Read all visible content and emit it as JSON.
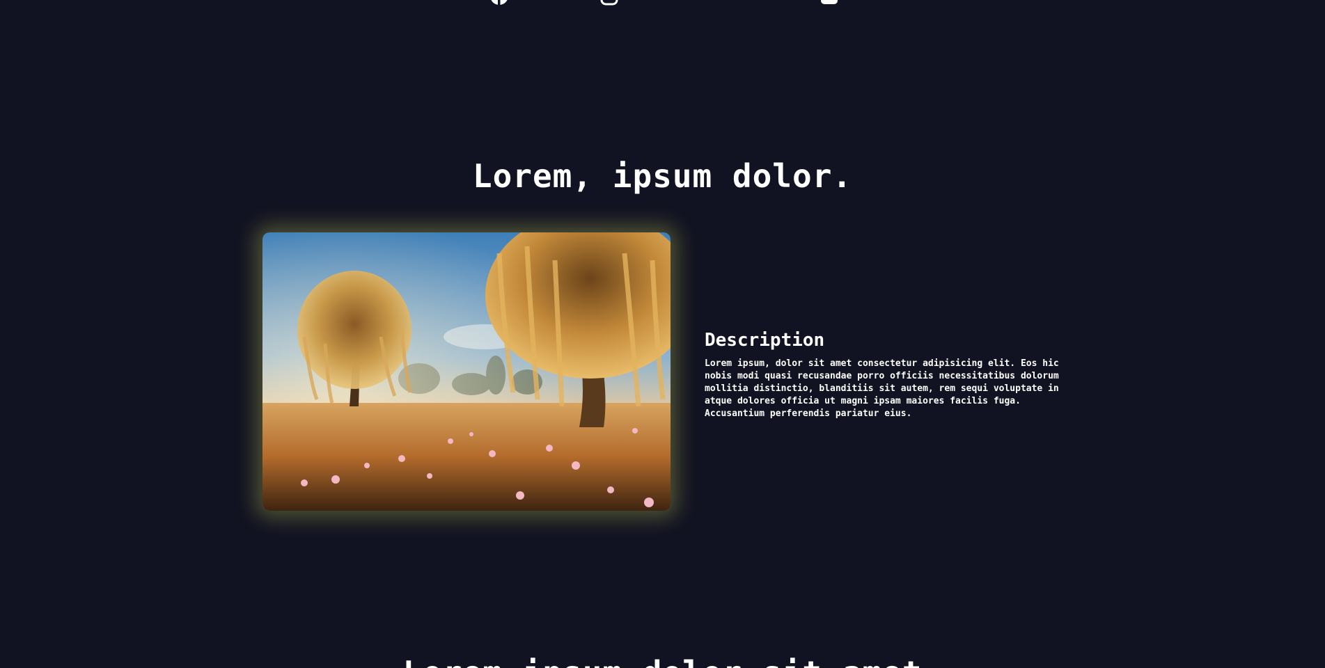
{
  "social": {
    "icons": [
      "facebook-icon",
      "instagram-icon",
      "twitter-icon",
      "youtube-icon"
    ],
    "color": "#ffffff"
  },
  "section": {
    "title": "Lorem, ipsum dolor.",
    "image_alt_semantic": "willow-field-photo",
    "glow_color": "#969f46",
    "description": {
      "title": "Description",
      "text": "Lorem ipsum, dolor sit amet consectetur adipisicing elit. Eos hic nobis modi quasi recusandae porro officiis necessitatibus dolorum mollitia distinctio, blanditiis sit autem, rem sequi voluptate in atque dolores officia ut magni ipsam maiores facilis fuga. Accusantium perferendis pariatur eius."
    }
  },
  "next_section": {
    "title": "Lorem ipsum dolor sit amet"
  },
  "colors": {
    "background": "#121322",
    "text": "#ffffff"
  }
}
